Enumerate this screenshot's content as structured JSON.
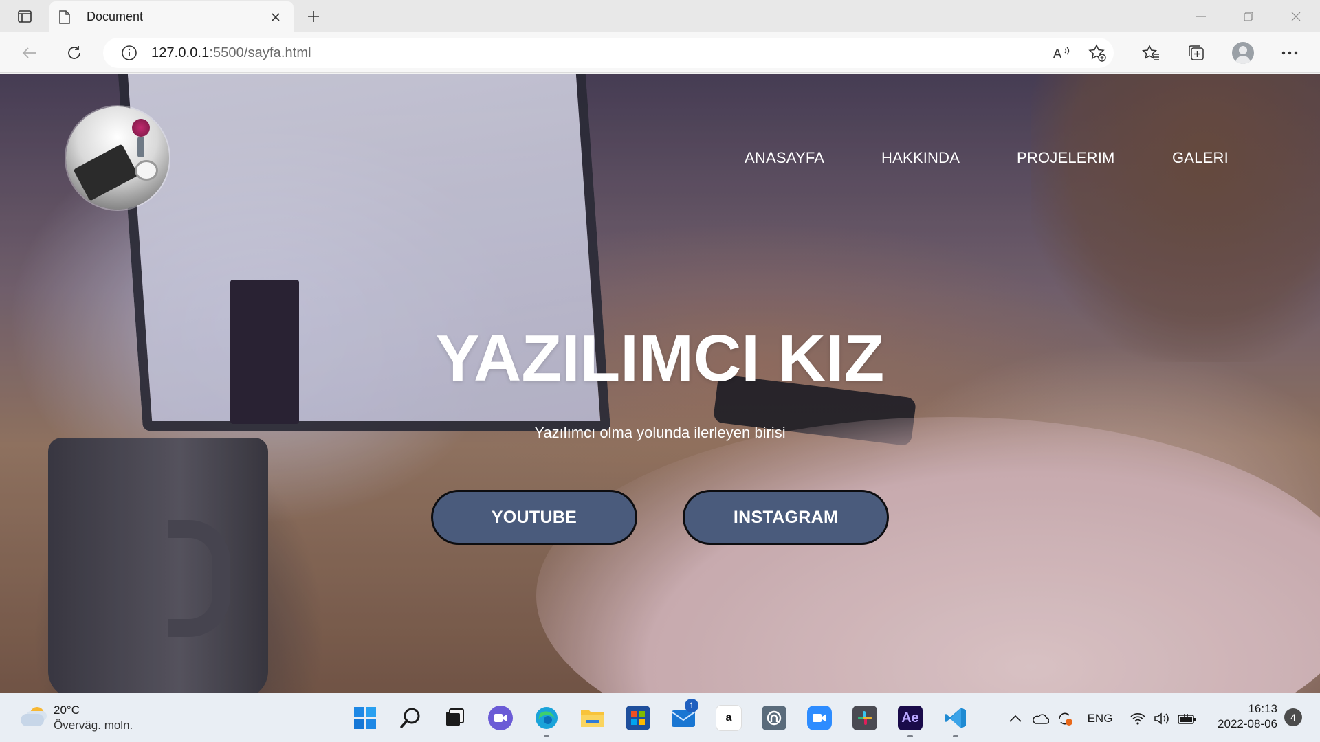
{
  "browser": {
    "tab": {
      "title": "Document",
      "icon": "document-icon"
    },
    "url": {
      "host": "127.0.0.1",
      "rest": ":5500/sayfa.html"
    }
  },
  "page": {
    "nav": [
      "ANASAYFA",
      "HAKKINDA",
      "PROJELERIM",
      "GALERI"
    ],
    "hero": {
      "title": "YAZILIMCI KIZ",
      "subtitle": "Yazılımcı olma yolunda ilerleyen birisi",
      "buttons": [
        "YOUTUBE",
        "INSTAGRAM"
      ]
    },
    "colors": {
      "button_bg": "#4a5b7c",
      "button_border": "#0d0d10",
      "text": "#ffffff"
    }
  },
  "taskbar": {
    "weather": {
      "temp": "20°C",
      "desc": "Överväg. moln."
    },
    "apps": [
      "start-icon",
      "search-icon",
      "task-view-icon",
      "chat-icon",
      "edge-icon",
      "file-explorer-icon",
      "store-icon",
      "mail-icon",
      "amazon-icon",
      "app-icon",
      "zoom-icon",
      "slack-icon",
      "after-effects-icon",
      "vscode-icon"
    ],
    "mail_badge": "1",
    "amazon_label": "a",
    "ae_label": "Ae",
    "lang": "ENG",
    "time": "16:13",
    "date": "2022-08-06",
    "notifications": "4"
  }
}
